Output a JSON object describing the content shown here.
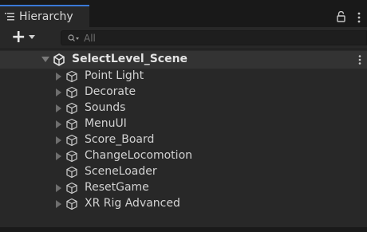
{
  "tab": {
    "title": "Hierarchy",
    "icon": "hierarchy-list-icon"
  },
  "header_icons": [
    "lock-icon",
    "kebab-menu-icon"
  ],
  "toolbar": {
    "add_icon": "plus-icon",
    "add_dropdown_icon": "chevron-down-icon"
  },
  "search": {
    "placeholder": "All",
    "value": "",
    "icon": "search-icon"
  },
  "scene": {
    "name": "SelectLevel_Scene",
    "icon": "unity-scene-icon",
    "expanded": true
  },
  "items": [
    {
      "label": "Point Light",
      "has_children": true
    },
    {
      "label": "Decorate",
      "has_children": true
    },
    {
      "label": "Sounds",
      "has_children": true
    },
    {
      "label": "MenuUI",
      "has_children": true
    },
    {
      "label": "Score_Board",
      "has_children": true
    },
    {
      "label": "ChangeLocomotion",
      "has_children": true
    },
    {
      "label": "SceneLoader",
      "has_children": false
    },
    {
      "label": "ResetGame",
      "has_children": true
    },
    {
      "label": "XR Rig Advanced",
      "has_children": true
    }
  ],
  "colors": {
    "tab_accent": "#3a79d8",
    "panel_bg": "#282828",
    "selected_row": "#333333"
  }
}
